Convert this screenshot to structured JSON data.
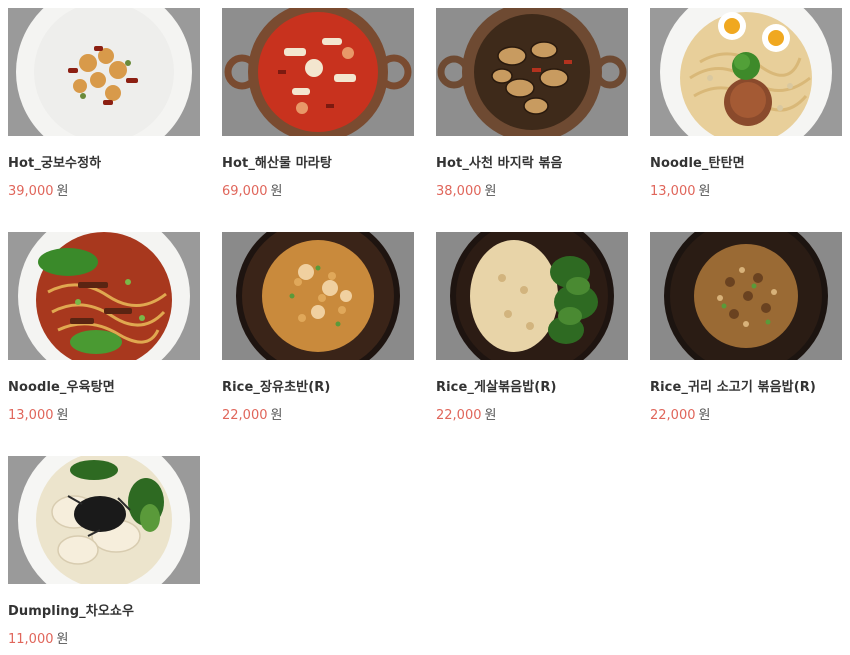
{
  "currency": "원",
  "items": [
    {
      "name": "Hot_궁보수정하",
      "price": "39,000",
      "icon": "kung-pao-shrimp-photo"
    },
    {
      "name": "Hot_해산물 마라탕",
      "price": "69,000",
      "icon": "seafood-malatang-photo"
    },
    {
      "name": "Hot_사천 바지락 볶음",
      "price": "38,000",
      "icon": "sichuan-clam-stirfry-photo"
    },
    {
      "name": "Noodle_탄탄면",
      "price": "13,000",
      "icon": "dandan-noodle-photo"
    },
    {
      "name": "Noodle_우육탕면",
      "price": "13,000",
      "icon": "beef-noodle-soup-photo"
    },
    {
      "name": "Rice_장유초반(R)",
      "price": "22,000",
      "icon": "soy-fried-rice-photo"
    },
    {
      "name": "Rice_게살볶음밥(R)",
      "price": "22,000",
      "icon": "crab-fried-rice-photo"
    },
    {
      "name": "Rice_귀리 소고기 볶음밥(R)",
      "price": "22,000",
      "icon": "oat-beef-fried-rice-photo"
    },
    {
      "name": "Dumpling_차오쇼우",
      "price": "11,000",
      "icon": "chaoshou-dumpling-photo"
    }
  ],
  "colors": {
    "price": "#e0665b",
    "name": "#333333",
    "photo_bg": "#8f8f8f"
  }
}
